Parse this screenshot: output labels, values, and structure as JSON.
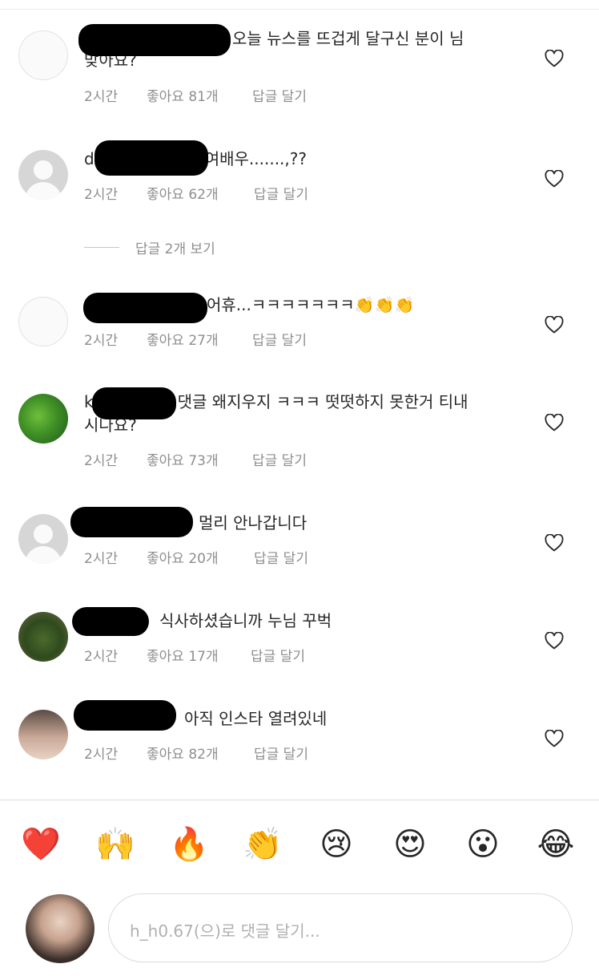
{
  "comments": [
    {
      "text_line1": "오늘 뉴스를 뜨겁게 달구신 분이 님",
      "text_line2": "맞아요?",
      "time": "2시간",
      "likes": "좋아요 81개",
      "reply": "답글 달기"
    },
    {
      "prefix": "d",
      "text": "여배우.......,??",
      "time": "2시간",
      "likes": "좋아요 62개",
      "reply": "답글 달기"
    },
    {
      "text": "어휴...ㅋㅋㅋㅋㅋㅋㅋ👏👏👏",
      "time": "2시간",
      "likes": "좋아요 27개",
      "reply": "답글 달기"
    },
    {
      "prefix": "k",
      "text_line1": "댓글 왜지우지 ㅋㅋㅋ 떳떳하지 못한거 티내",
      "text_line2": "시나요?",
      "time": "2시간",
      "likes": "좋아요 73개",
      "reply": "답글 달기"
    },
    {
      "text": "멀리 안나갑니다",
      "time": "2시간",
      "likes": "좋아요 20개",
      "reply": "답글 달기"
    },
    {
      "text": "식사하셨습니까 누님  꾸벅",
      "time": "2시간",
      "likes": "좋아요 17개",
      "reply": "답글 달기"
    },
    {
      "text": "아직 인스타 열려있네",
      "time": "2시간",
      "likes": "좋아요 82개",
      "reply": "답글 달기"
    }
  ],
  "view_replies": "답글 2개 보기",
  "emoji_bar": [
    "❤️",
    "🙌",
    "🔥",
    "👏",
    "😢",
    "😍",
    "😮",
    "😂"
  ],
  "composer": {
    "placeholder": "h_h0.67(으)로 댓글 달기..."
  },
  "icons": {
    "like": "heart-outline-icon"
  }
}
